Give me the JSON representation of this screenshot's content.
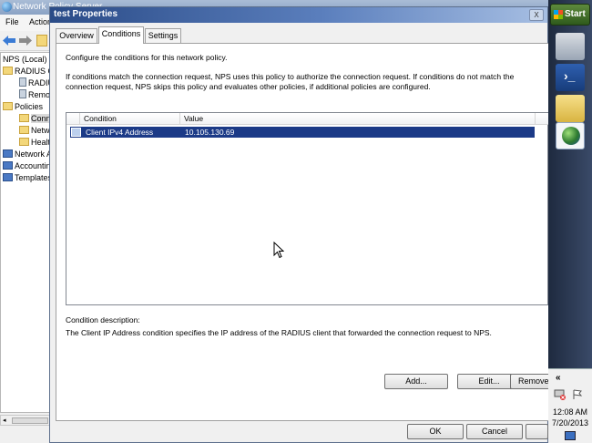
{
  "bg_window": {
    "title": "Network Policy Server",
    "menu": [
      "File",
      "Action"
    ],
    "tree": [
      {
        "label": "NPS (Local)",
        "icon": "server-icon"
      },
      {
        "label": "RADIUS Clients and Servers",
        "icon": "folder-icon"
      },
      {
        "label": "RADIUS Clients",
        "icon": "server-icon"
      },
      {
        "label": "Remote RADIUS Server Groups",
        "icon": "server-icon"
      },
      {
        "label": "Policies",
        "icon": "folder-icon"
      },
      {
        "label": "Connection Request Policies",
        "icon": "folder-icon"
      },
      {
        "label": "Network Policies",
        "icon": "folder-icon"
      },
      {
        "label": "Health Policies",
        "icon": "folder-icon"
      },
      {
        "label": "Network Access Protection",
        "icon": "net-icon"
      },
      {
        "label": "Accounting",
        "icon": "net-icon"
      },
      {
        "label": "Templates Management",
        "icon": "net-icon"
      }
    ]
  },
  "dialog": {
    "title": "test Properties",
    "close_label": "X",
    "tabs": [
      {
        "label": "Overview"
      },
      {
        "label": "Conditions"
      },
      {
        "label": "Settings"
      }
    ],
    "intro": "Configure the conditions for this network policy.",
    "explanation_line1": "If conditions match the connection request, NPS uses this policy to authorize the connection request. If conditions do not match the",
    "explanation_line2": "connection request, NPS skips this policy and evaluates other policies, if additional policies are configured.",
    "list": {
      "columns": [
        "Condition",
        "Value"
      ],
      "rows": [
        {
          "condition": "Client IPv4 Address",
          "value": "10.105.130.69"
        }
      ]
    },
    "description_label": "Condition description:",
    "description_text": "The Client IP Address condition specifies the IP address of the RADIUS client that forwarded the connection request to NPS.",
    "buttons": {
      "add": "Add...",
      "edit": "Edit...",
      "remove": "Remove",
      "ok": "OK",
      "cancel": "Cancel"
    }
  },
  "taskbar": {
    "start_label": "Start",
    "chevron": "«",
    "time": "12:08 AM",
    "date": "7/20/2013"
  }
}
